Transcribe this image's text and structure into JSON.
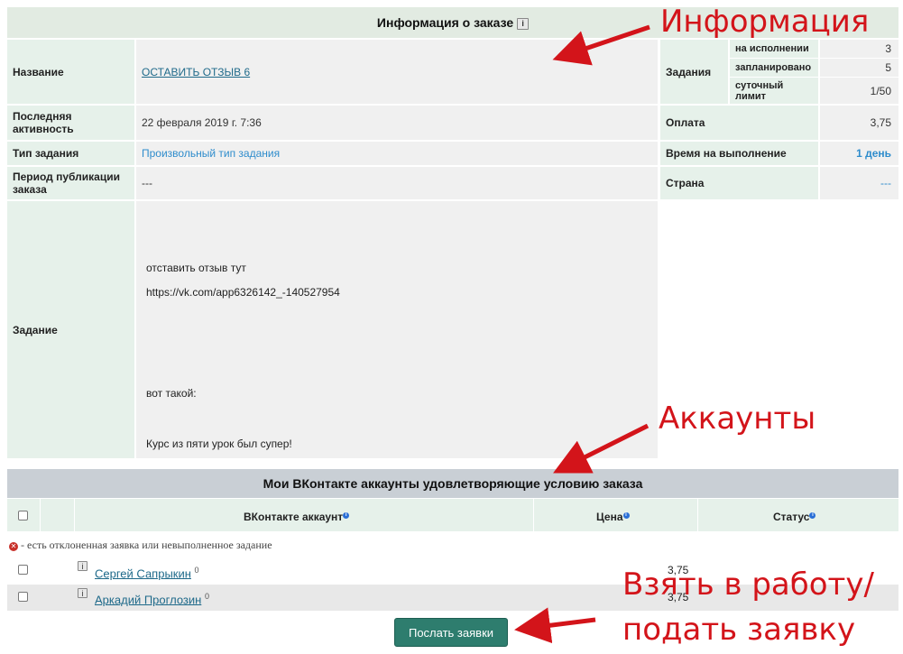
{
  "info": {
    "title": "Информация о заказе",
    "name_label": "Название",
    "name_value": "ОСТАВИТЬ ОТЗЫВ 6",
    "activity_label": "Последняя активность",
    "activity_value": "22 февраля 2019 г. 7:36",
    "type_label": "Тип задания",
    "type_value": "Произвольный тип задания",
    "period_label": "Период публикации заказа",
    "period_value": "---",
    "task_label": "Задание",
    "task_lines": [
      "отставить отзыв тут",
      "https://vk.com/app6326142_-140527954",
      "вот такой:",
      "Курс из пяти урок был супер!"
    ],
    "tasks_label": "Задания",
    "in_progress_label": "на исполнении",
    "in_progress_value": "3",
    "planned_label": "запланировано",
    "planned_value": "5",
    "daily_label": "суточный лимит",
    "daily_value": "1/50",
    "payment_label": "Оплата",
    "payment_value": "3,75",
    "time_label": "Время на выполнение",
    "time_value": "1 день",
    "country_label": "Страна",
    "country_value": "---"
  },
  "accounts": {
    "title": "Мои ВКонтакте аккаунты удовлетворяющие условию заказа",
    "col_account": "ВКонтакте аккаунт",
    "col_price": "Цена",
    "col_status": "Статус",
    "note": "- есть отклоненная заявка или невыполненное задание",
    "rows": [
      {
        "name": "Сергей Сапрыкин",
        "count": "0",
        "price": "3,75"
      },
      {
        "name": "Аркадий Проглозин",
        "count": "0",
        "price": "3,75"
      }
    ],
    "submit_label": "Послать заявки"
  },
  "callouts": {
    "info": "Информация",
    "accounts": "Аккаунты",
    "take_line1": "Взять в работу/",
    "take_line2": "подать заявку"
  },
  "colors": {
    "accent": "#d3141a",
    "button": "#2e7d6e",
    "link": "#2e8ccc"
  }
}
